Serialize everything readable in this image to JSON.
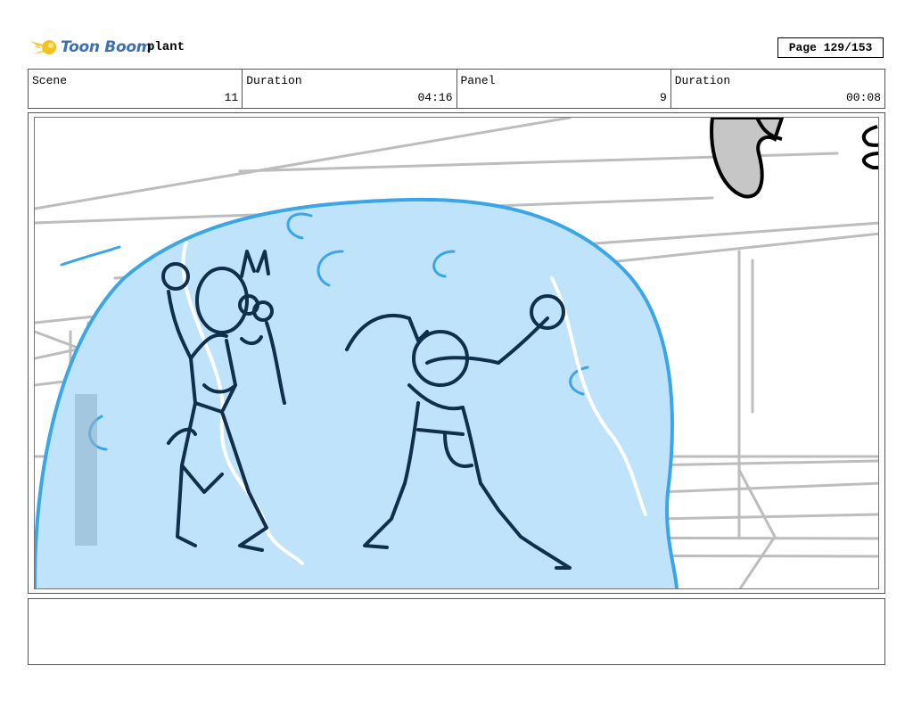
{
  "header": {
    "brand": "Toon Boom",
    "project_name": "plant",
    "page_indicator": "Page 129/153"
  },
  "info": {
    "scene_label": "Scene",
    "scene_value": "11",
    "scene_duration_label": "Duration",
    "scene_duration_value": "04:16",
    "panel_label": "Panel",
    "panel_value": "9",
    "panel_duration_label": "Duration",
    "panel_duration_value": "00:08"
  },
  "colors": {
    "brand_blue": "#3d6fb3",
    "logo_yellow": "#f4c21c",
    "bubble_fill": "#bfe3fb",
    "bubble_stroke": "#3aa6e8",
    "ink": "#0f2f4d",
    "background_lines": "#bdbdbd"
  },
  "icons": {
    "logo": "toon-boom-comet-icon"
  }
}
